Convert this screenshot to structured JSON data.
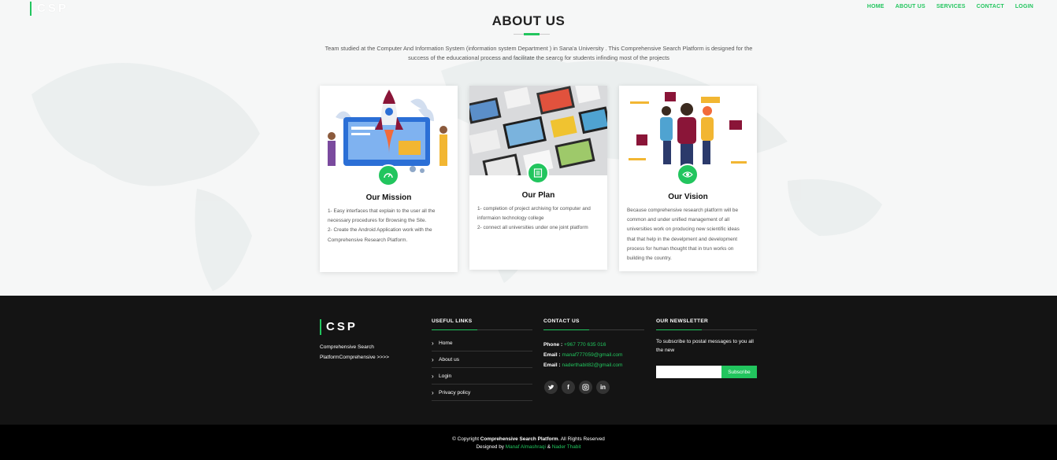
{
  "header": {
    "brand": "CSP",
    "nav": [
      "HOME",
      "ABOUT US",
      "SERVICES",
      "CONTACT",
      "LOGIN"
    ]
  },
  "about": {
    "title": "ABOUT US",
    "intro": "Team studied at the Computer And Information System (information system Department ) in Sana'a University . This Comprehensive Search Platform is designed for the success of the eduucational process and facilitate the searcg for students infinding most of the projects",
    "cards": [
      {
        "title": "Our Mission",
        "icon": "gauge-icon",
        "lines": [
          "1- Easy interfaces that explain to the user all the necessary procedures for Browsing the Site.",
          "2- Create the Android Application work with the Comprehensive Research Platform."
        ]
      },
      {
        "title": "Our Plan",
        "icon": "list-icon",
        "lines": [
          "1- completion of project archiving for computer and informaion technology college",
          "2- connect all universities under one joint platform"
        ]
      },
      {
        "title": "Our Vision",
        "icon": "eye-icon",
        "lines": [
          "Because comprehensive research platform will be common and under unified management of all universities work on producing new scientific ideas that that help in the develpment and development process for human thought that in trun works on building the country."
        ]
      }
    ]
  },
  "footer": {
    "brand": "CSP",
    "description": "Comprehensive Search PlatformComprehensive >>>>",
    "useful_links": {
      "title": "USEFUL LINKS",
      "items": [
        "Home",
        "About us",
        "Login",
        "Privacy policy"
      ]
    },
    "contact": {
      "title": "CONTACT US",
      "phone_label": "Phone :",
      "phone": "+967 770 635 016",
      "email_label": "Email :",
      "email1": "manaf777059@gmail.com",
      "email2": "naderthabit82@gmail.com",
      "social": [
        "twitter-icon",
        "facebook-icon",
        "instagram-icon",
        "linkedin-icon"
      ]
    },
    "newsletter": {
      "title": "OUR NEWSLETTER",
      "text": "To subscribe to postal messages to you all the new",
      "input_value": "",
      "button": "Subscribe"
    }
  },
  "bottom": {
    "copyright_prefix": "© Copyright",
    "copyright_name": "Comprehensive Search Platform",
    "copyright_suffix": ". All Rights Reserved",
    "designed_by": "Designed by",
    "author1": "Manaf Almashraqi",
    "amp": "&",
    "author2": "Nader Thabit"
  },
  "colors": {
    "accent": "#22c55e",
    "footer_bg": "#141414",
    "bottom_bg": "#000000"
  }
}
